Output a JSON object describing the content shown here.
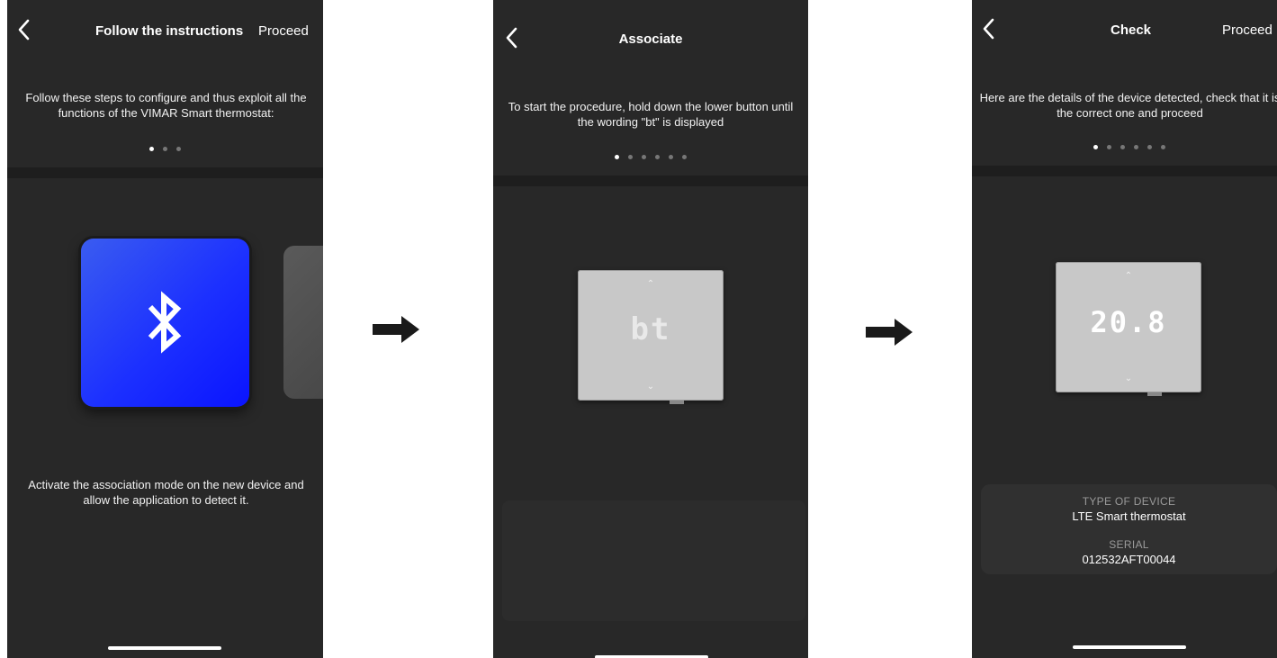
{
  "screens": [
    {
      "title": "Follow the instructions",
      "action": "Proceed",
      "instruction": "Follow these steps to configure and thus exploit all the functions of the VIMAR Smart thermostat:",
      "dots_total": 3,
      "dots_active": 1,
      "card_icon": "bluetooth-icon",
      "footer_text": "Activate the association mode on the new device and allow the application to detect it."
    },
    {
      "title": "Associate",
      "instruction": "To start the procedure, hold down the lower button until the wording \"bt\" is displayed",
      "dots_total": 6,
      "dots_active": 1,
      "display_text": "bt"
    },
    {
      "title": "Check",
      "action": "Proceed",
      "instruction": "Here are the details of the device detected, check that it is the correct one and proceed",
      "dots_total": 6,
      "dots_active": 1,
      "display_text": "20.8",
      "device_type_label": "TYPE OF DEVICE",
      "device_type_value": "LTE Smart thermostat",
      "serial_label": "SERIAL",
      "serial_value": "012532AFT00044"
    }
  ],
  "colors": {
    "screen_bg": "#282828",
    "bluetooth_card_from": "#3a5cf0",
    "bluetooth_card_to": "#0a14ff"
  },
  "icons": [
    "back-chevron-icon",
    "bluetooth-icon",
    "right-arrow-icon",
    "chevron-up-icon",
    "chevron-down-icon"
  ]
}
